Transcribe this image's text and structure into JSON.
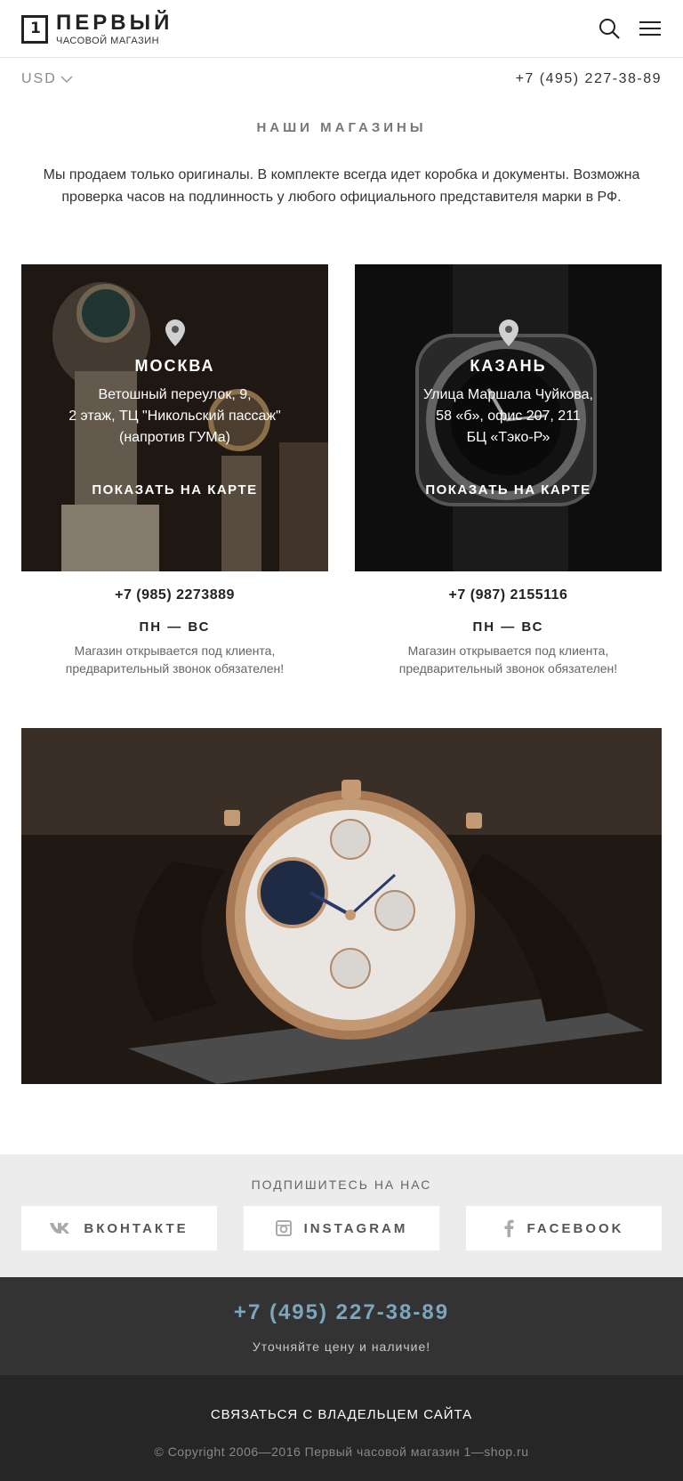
{
  "header": {
    "logo_digit": "1",
    "logo_title": "ПЕРВЫЙ",
    "logo_subtitle": "ЧАСОВОЙ МАГАЗИН",
    "search_icon": "search-icon",
    "menu_icon": "hamburger-menu-icon"
  },
  "subbar": {
    "currency": "USD",
    "phone": "+7 (495) 227-38-89"
  },
  "main": {
    "title": "НАШИ МАГАЗИНЫ",
    "intro": "Мы продаем только оригиналы. В комплекте всегда идет коробка и документы. Возможна проверка часов на подлинность у любого официального представителя марки в РФ."
  },
  "stores": [
    {
      "city": "МОСКВА",
      "address": "Ветошный переулок, 9,\n2 этаж, ТЦ \"Никольский пассаж\"\n(напротив ГУМа)",
      "map_link": "ПОКАЗАТЬ НА КАРТЕ",
      "phone": "+7 (985) 2273889",
      "hours": "ПН — ВС",
      "note": "Магазин открывается под клиента, предварительный звонок обязателен!"
    },
    {
      "city": "КАЗАНЬ",
      "address": "Улица Маршала Чуйкова,\n58 «б», офис 207, 211\nБЦ «Тэко-Р»",
      "map_link": "ПОКАЗАТЬ НА КАРТЕ",
      "phone": "+7 (987) 2155116",
      "hours": "ПН — ВС",
      "note": "Магазин открывается под клиента, предварительный звонок обязателен!"
    }
  ],
  "subscribe": {
    "title": "ПОДПИШИТЕСЬ НА НАС",
    "links": [
      {
        "label": "ВКОНТАКТЕ",
        "icon": "vk-icon"
      },
      {
        "label": "INSTAGRAM",
        "icon": "instagram-icon"
      },
      {
        "label": "FACEBOOK",
        "icon": "facebook-icon"
      }
    ]
  },
  "footer": {
    "phone": "+7 (495) 227-38-89",
    "note": "Уточняйте цену и наличие!",
    "contact_owner": "СВЯЗАТЬСЯ С ВЛАДЕЛЬЦЕМ САЙТА",
    "copyright": "© Copyright 2006—2016 Первый часовой магазин 1—shop.ru"
  },
  "colors": {
    "accent_phone": "#7aa7bd",
    "footer_top": "#333333",
    "footer_bottom": "#262626",
    "subscribe_bg": "#ececec"
  }
}
